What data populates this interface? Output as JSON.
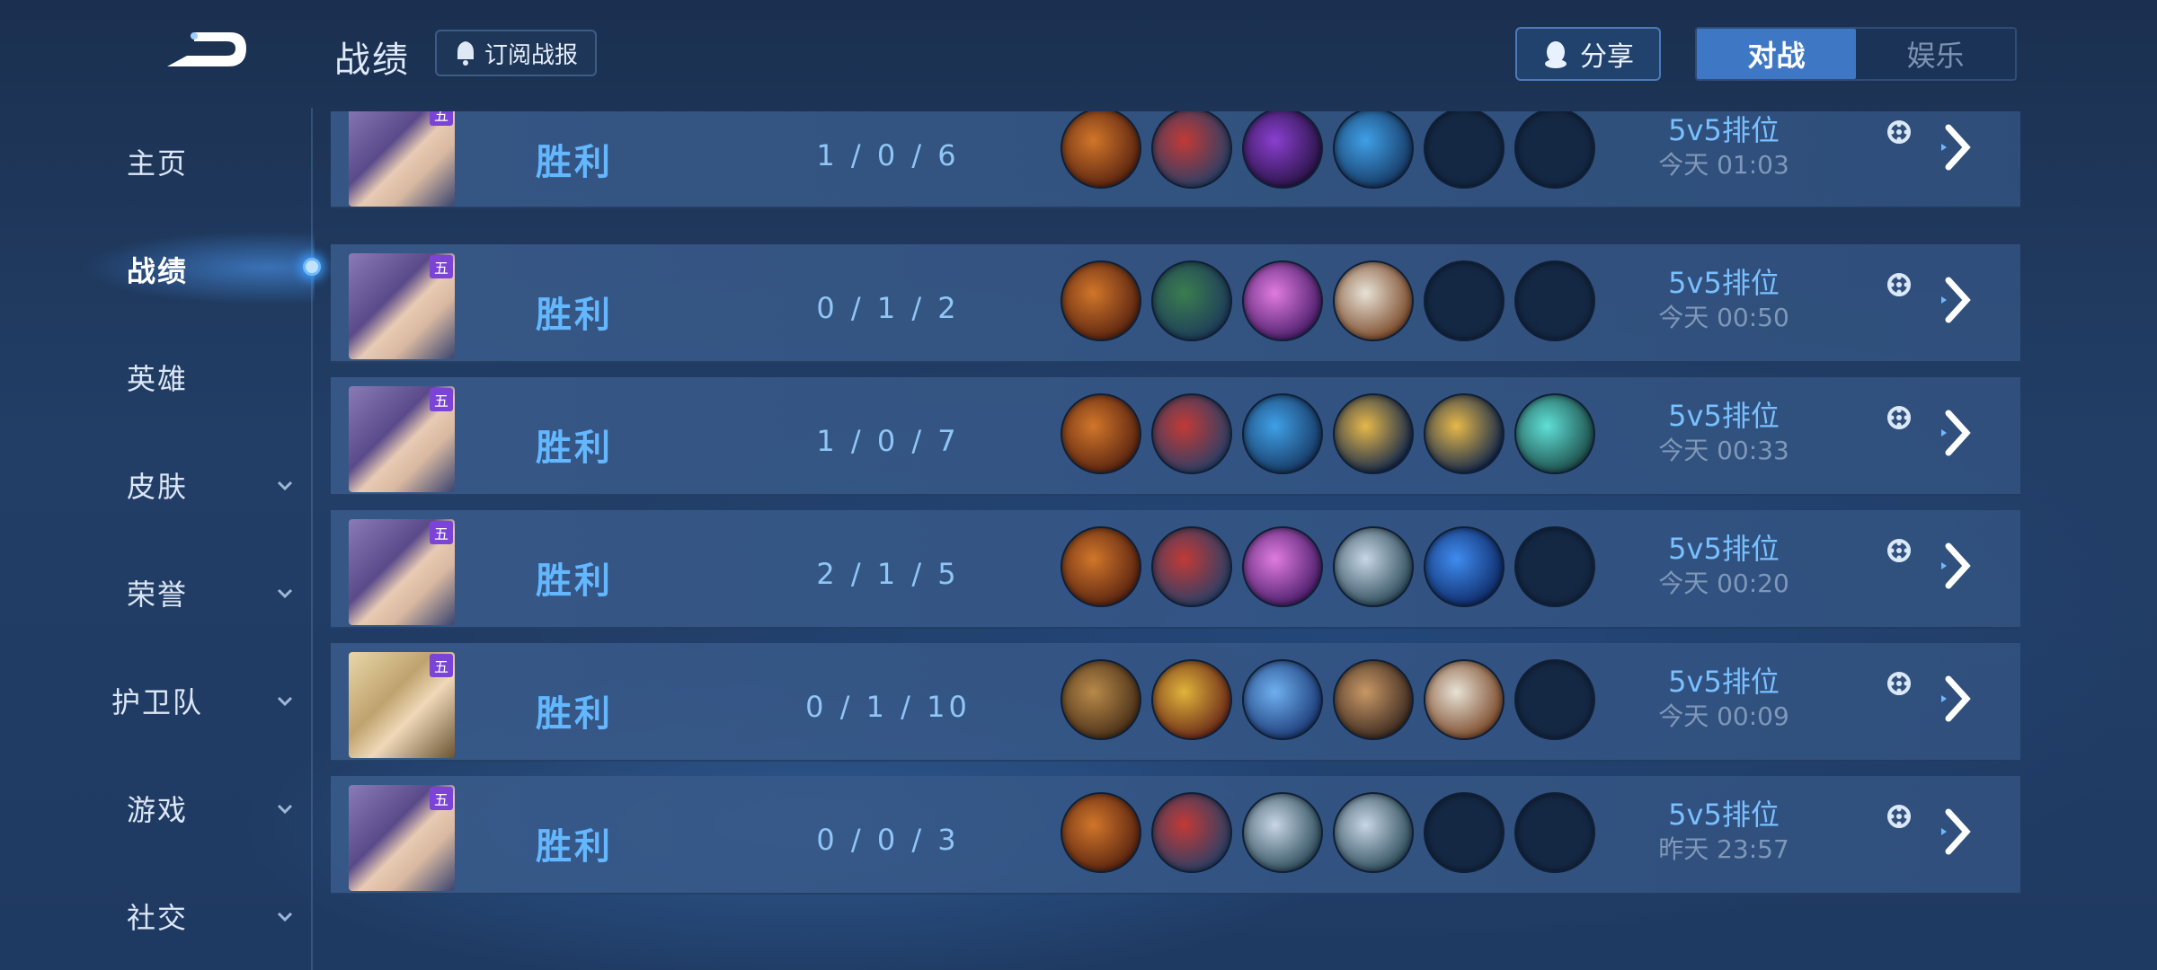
{
  "header": {
    "title": "战绩",
    "subscribe_label": "订阅战报",
    "share_label": "分享",
    "tabs": [
      {
        "label": "对战",
        "active": true
      },
      {
        "label": "娱乐",
        "active": false
      }
    ]
  },
  "sidebar": {
    "items": [
      {
        "label": "主页",
        "has_chevron": false,
        "active": false
      },
      {
        "label": "战绩",
        "has_chevron": false,
        "active": true
      },
      {
        "label": "英雄",
        "has_chevron": false,
        "active": false
      },
      {
        "label": "皮肤",
        "has_chevron": true,
        "active": false
      },
      {
        "label": "荣誉",
        "has_chevron": true,
        "active": false
      },
      {
        "label": "护卫队",
        "has_chevron": true,
        "active": false
      },
      {
        "label": "游戏",
        "has_chevron": true,
        "active": false
      },
      {
        "label": "社交",
        "has_chevron": true,
        "active": false
      }
    ]
  },
  "records": [
    {
      "hero_icon": "purple-hair-hero-avatar",
      "badge": "五",
      "result": "胜利",
      "kda": "1 / 0 / 6",
      "items": [
        "orange-cloak",
        "red-boots",
        "purple-armor",
        "blue-orb",
        "empty",
        "empty"
      ],
      "mode": "5v5排位",
      "time": "今天 01:03"
    },
    {
      "hero_icon": "purple-hair-hero-avatar",
      "badge": "五",
      "result": "胜利",
      "kda": "0 / 1 / 2",
      "items": [
        "orange-cloak",
        "green-boots",
        "pink-cape",
        "white-chest",
        "empty",
        "empty"
      ],
      "mode": "5v5排位",
      "time": "今天 00:50"
    },
    {
      "hero_icon": "purple-hair-hero-avatar",
      "badge": "五",
      "result": "胜利",
      "kda": "1 / 0 / 7",
      "items": [
        "orange-cloak",
        "red-boots",
        "blue-orb",
        "amulet",
        "amulet",
        "teal-staff"
      ],
      "mode": "5v5排位",
      "time": "今天 00:33"
    },
    {
      "hero_icon": "purple-hair-hero-avatar",
      "badge": "五",
      "result": "胜利",
      "kda": "2 / 1 / 5",
      "items": [
        "orange-cloak",
        "red-boots",
        "pink-cape",
        "silver-bracer",
        "blue-blade",
        "empty"
      ],
      "mode": "5v5排位",
      "time": "今天 00:20"
    },
    {
      "hero_icon": "blonde-hero-avatar",
      "badge": "五",
      "result": "胜利",
      "kda": "0 / 1 / 10",
      "items": [
        "wood-shield",
        "gold-boots",
        "hourglass",
        "bronze-armor",
        "white-chest",
        "empty"
      ],
      "mode": "5v5排位",
      "time": "今天 00:09"
    },
    {
      "hero_icon": "purple-hair-hero-avatar",
      "badge": "五",
      "result": "胜利",
      "kda": "0 / 0 / 3",
      "items": [
        "orange-cloak",
        "red-boots",
        "silver-bracer",
        "silver-bracer",
        "empty",
        "empty"
      ],
      "mode": "5v5排位",
      "time": "昨天 23:57"
    }
  ],
  "colors": {
    "accent": "#3e78c4",
    "victory": "#63b7ff",
    "background": "#223e66"
  }
}
